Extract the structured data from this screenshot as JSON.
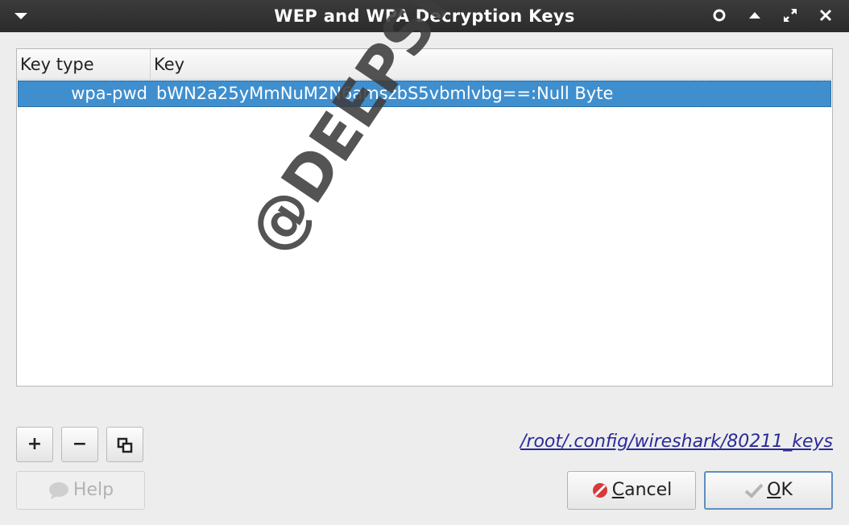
{
  "window": {
    "title": "WEP and WPA Decryption Keys",
    "controls": {
      "circle": "○",
      "up": "▲",
      "maximize": "⤢",
      "close": "✕"
    }
  },
  "table": {
    "columns": [
      "Key type",
      "Key"
    ],
    "rows": [
      {
        "key_type": "wpa-pwd",
        "key": "bWN2a25yMmNuM2N6amszbS5vbmlvbg==:Null Byte",
        "selected": true
      }
    ]
  },
  "watermark": "@DEEPSIDE",
  "toolbar": {
    "add_label": "+",
    "remove_label": "−",
    "copy_label": "⧉"
  },
  "file_path": "/root/.config/wireshark/80211_keys",
  "buttons": {
    "help": "Help",
    "cancel_prefix": "",
    "cancel_mnemonic": "C",
    "cancel_rest": "ancel",
    "ok_mnemonic": "O",
    "ok_rest": "K"
  },
  "colors": {
    "titlebar": "#2b2b2b",
    "selection": "#3f8fcf",
    "link": "#2a2a9a",
    "cancel_icon": "#d63a3a"
  }
}
